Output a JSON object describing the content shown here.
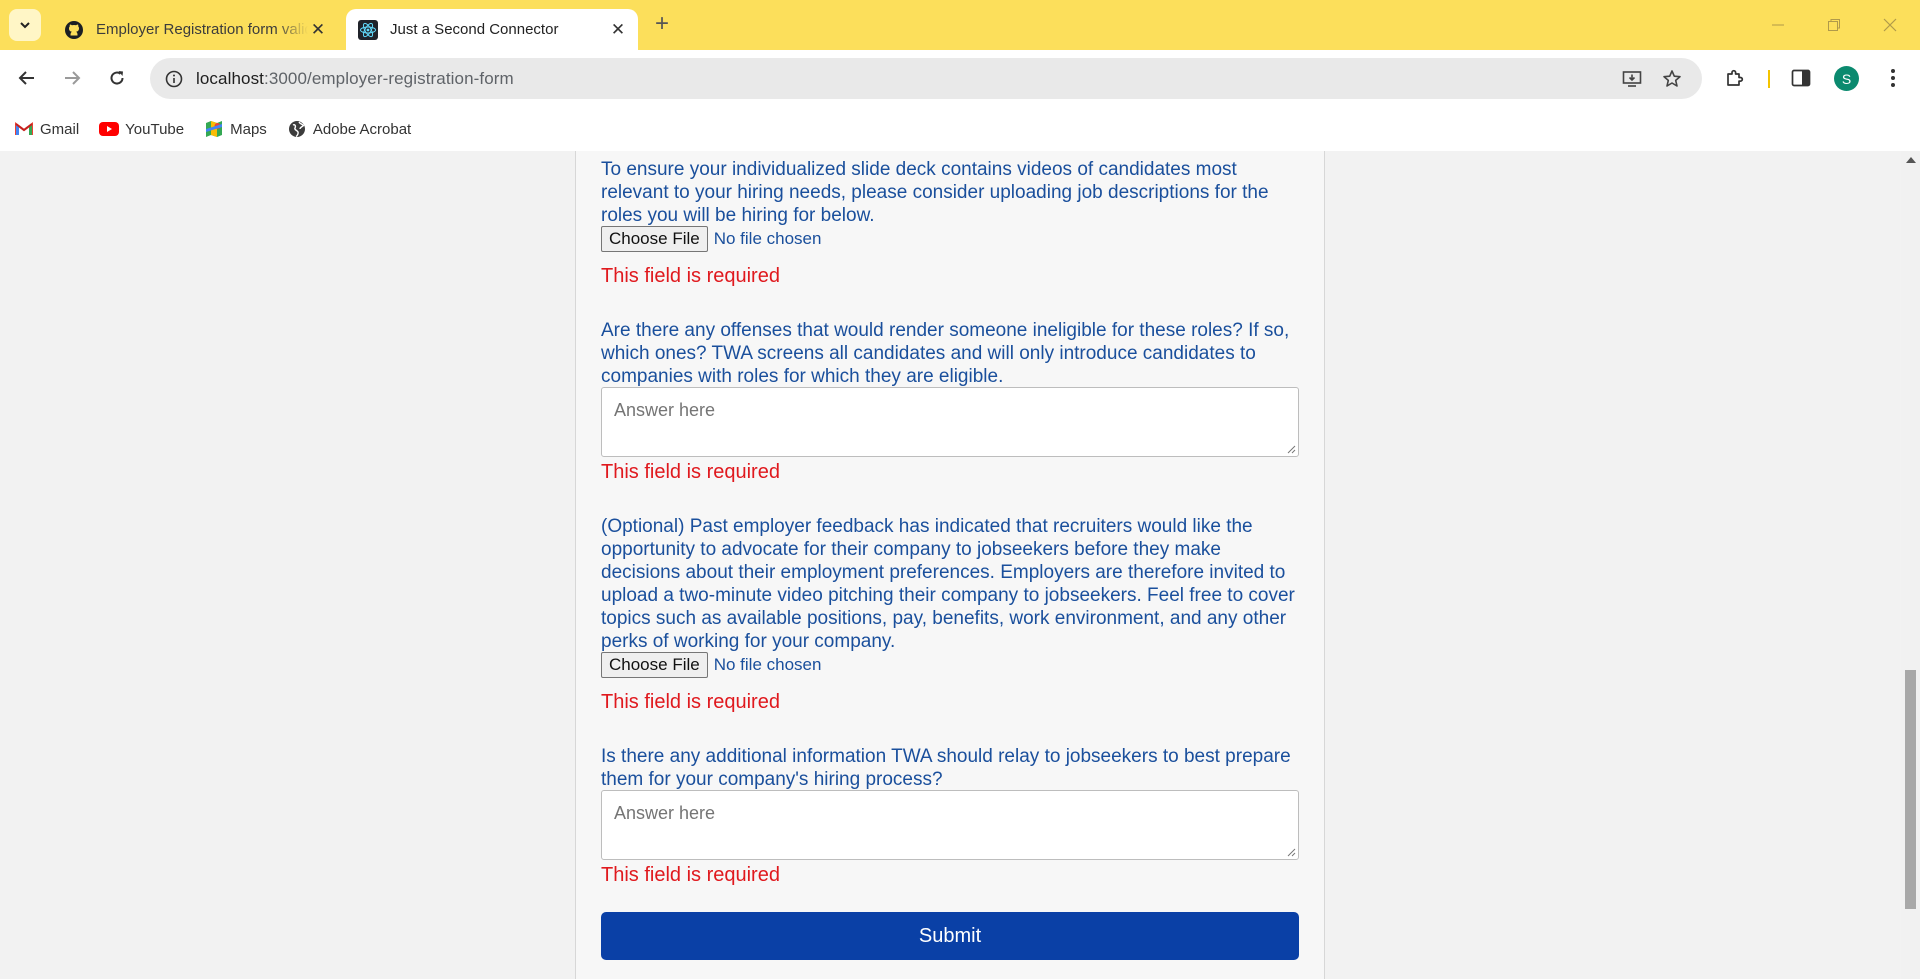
{
  "browser": {
    "tabs": [
      {
        "title": "Employer Registration form validation",
        "favicon": "github-icon",
        "active": false
      },
      {
        "title": "Just a Second Connector",
        "favicon": "react-icon",
        "active": true
      }
    ],
    "url_host": "localhost",
    "url_path": ":3000/employer-registration-form",
    "profile_initial": "S",
    "bookmarks": [
      {
        "label": "Gmail",
        "icon": "gmail-icon"
      },
      {
        "label": "YouTube",
        "icon": "youtube-icon"
      },
      {
        "label": "Maps",
        "icon": "maps-icon"
      },
      {
        "label": "Adobe Acrobat",
        "icon": "globe-icon"
      }
    ],
    "colors": {
      "tabstrip": "#fcdf5b",
      "avatar": "#0b8a6f"
    }
  },
  "form": {
    "q_job_descriptions": "To ensure your individualized slide deck contains videos of candidates most relevant to your hiring needs, please consider uploading job descriptions for the roles you will be hiring for below.",
    "file1_button": "Choose File",
    "file1_status": "No file chosen",
    "error1": "This field is required",
    "q_offenses": "Are there any offenses that would render someone ineligible for these roles? If so, which ones? TWA screens all candidates and will only introduce candidates to companies with roles for which they are eligible.",
    "answer1_placeholder": "Answer here",
    "error2": "This field is required",
    "q_video": "(Optional) Past employer feedback has indicated that recruiters would like the opportunity to advocate for their company to jobseekers before they make decisions about their employment preferences. Employers are therefore invited to upload a two-minute video pitching their company to jobseekers. Feel free to cover topics such as available positions, pay, benefits, work environment, and any other perks of working for your company.",
    "file2_button": "Choose File",
    "file2_status": "No file chosen",
    "error3": "This field is required",
    "q_additional": "Is there any additional information TWA should relay to jobseekers to best prepare them for your company's hiring process?",
    "answer2_placeholder": "Answer here",
    "error4": "This field is required",
    "submit_label": "Submit",
    "colors": {
      "text": "#1a4f9c",
      "error": "#e0191e",
      "submit": "#0a40a6"
    }
  }
}
